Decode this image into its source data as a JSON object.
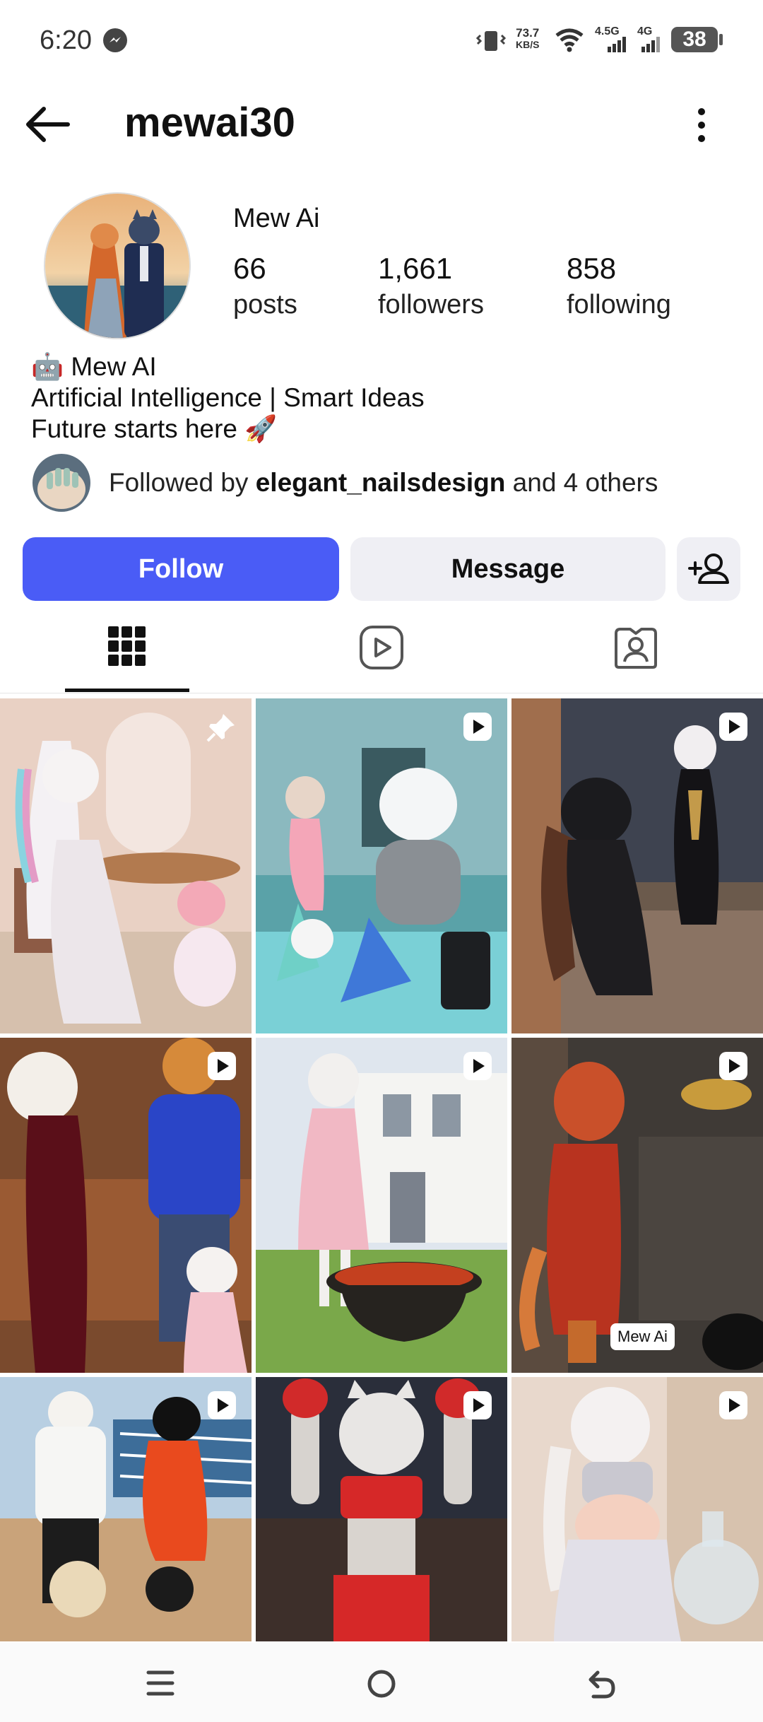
{
  "status_bar": {
    "time": "6:20",
    "speed_value": "73.7",
    "speed_unit": "KB/S",
    "net1": "4.5G",
    "net2": "4G",
    "battery": "38"
  },
  "header": {
    "username": "mewai30",
    "back_icon": "arrow-left-icon",
    "more_icon": "more-vertical-icon"
  },
  "profile": {
    "display_name": "Mew Ai",
    "stats": [
      {
        "count": "66",
        "label": "posts"
      },
      {
        "count": "1,661",
        "label": "followers"
      },
      {
        "count": "858",
        "label": "following"
      }
    ],
    "bio": [
      "🤖 Mew AI",
      "Artificial Intelligence | Smart Ideas",
      "Future starts here 🚀"
    ],
    "followed_by": {
      "prefix": "Followed by ",
      "user": "elegant_nailsdesign",
      "suffix": " and 4 others"
    }
  },
  "actions": {
    "follow_label": "Follow",
    "message_label": "Message",
    "suggest_icon": "add-person-icon"
  },
  "tabs": [
    {
      "icon": "grid-icon",
      "active": true
    },
    {
      "icon": "reels-icon",
      "active": false
    },
    {
      "icon": "tagged-icon",
      "active": false
    }
  ],
  "grid": {
    "posts": [
      {
        "badge": "pin-icon"
      },
      {
        "badge": "reel-icon"
      },
      {
        "badge": "reel-icon"
      },
      {
        "badge": "reel-icon"
      },
      {
        "badge": "reel-icon"
      },
      {
        "badge": "reel-icon",
        "tag": "Mew Ai"
      },
      {
        "badge": "reel-icon"
      },
      {
        "badge": "reel-icon"
      },
      {
        "badge": "reel-icon"
      }
    ]
  },
  "colors": {
    "accent": "#4a5cf6",
    "secondary_button": "#efeff4"
  }
}
